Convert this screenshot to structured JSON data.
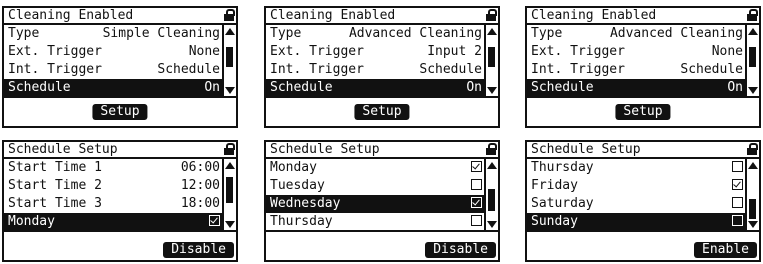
{
  "screens": [
    {
      "title": "Cleaning Enabled",
      "rows": [
        {
          "k": "Type",
          "v": "Simple Cleaning"
        },
        {
          "k": "Ext. Trigger",
          "v": "None"
        },
        {
          "k": "Int. Trigger",
          "v": "Schedule"
        },
        {
          "k": "Schedule",
          "v": "On"
        }
      ],
      "button": "Setup"
    },
    {
      "title": "Cleaning Enabled",
      "rows": [
        {
          "k": "Type",
          "v": "Advanced Cleaning"
        },
        {
          "k": "Ext. Trigger",
          "v": "Input 2"
        },
        {
          "k": "Int. Trigger",
          "v": "Schedule"
        },
        {
          "k": "Schedule",
          "v": "On"
        }
      ],
      "button": "Setup"
    },
    {
      "title": "Cleaning Enabled",
      "rows": [
        {
          "k": "Type",
          "v": "Advanced Cleaning"
        },
        {
          "k": "Ext. Trigger",
          "v": "None"
        },
        {
          "k": "Int. Trigger",
          "v": "Schedule"
        },
        {
          "k": "Schedule",
          "v": "On"
        }
      ],
      "button": "Setup"
    },
    {
      "title": "Schedule Setup",
      "rows": [
        {
          "k": "Start Time 1",
          "v": "06:00"
        },
        {
          "k": "Start Time 2",
          "v": "12:00"
        },
        {
          "k": "Start Time 3",
          "v": "18:00"
        },
        {
          "k": "Monday",
          "checked": true
        }
      ],
      "button": "Disable"
    },
    {
      "title": "Schedule Setup",
      "rows": [
        {
          "k": "Monday",
          "checked": true
        },
        {
          "k": "Tuesday",
          "checked": false
        },
        {
          "k": "Wednesday",
          "checked": true
        },
        {
          "k": "Thursday",
          "checked": false
        }
      ],
      "button": "Disable"
    },
    {
      "title": "Schedule Setup",
      "rows": [
        {
          "k": "Thursday",
          "checked": false
        },
        {
          "k": "Friday",
          "checked": true
        },
        {
          "k": "Saturday",
          "checked": false
        },
        {
          "k": "Sunday",
          "checked": false
        }
      ],
      "button": "Enable"
    }
  ]
}
